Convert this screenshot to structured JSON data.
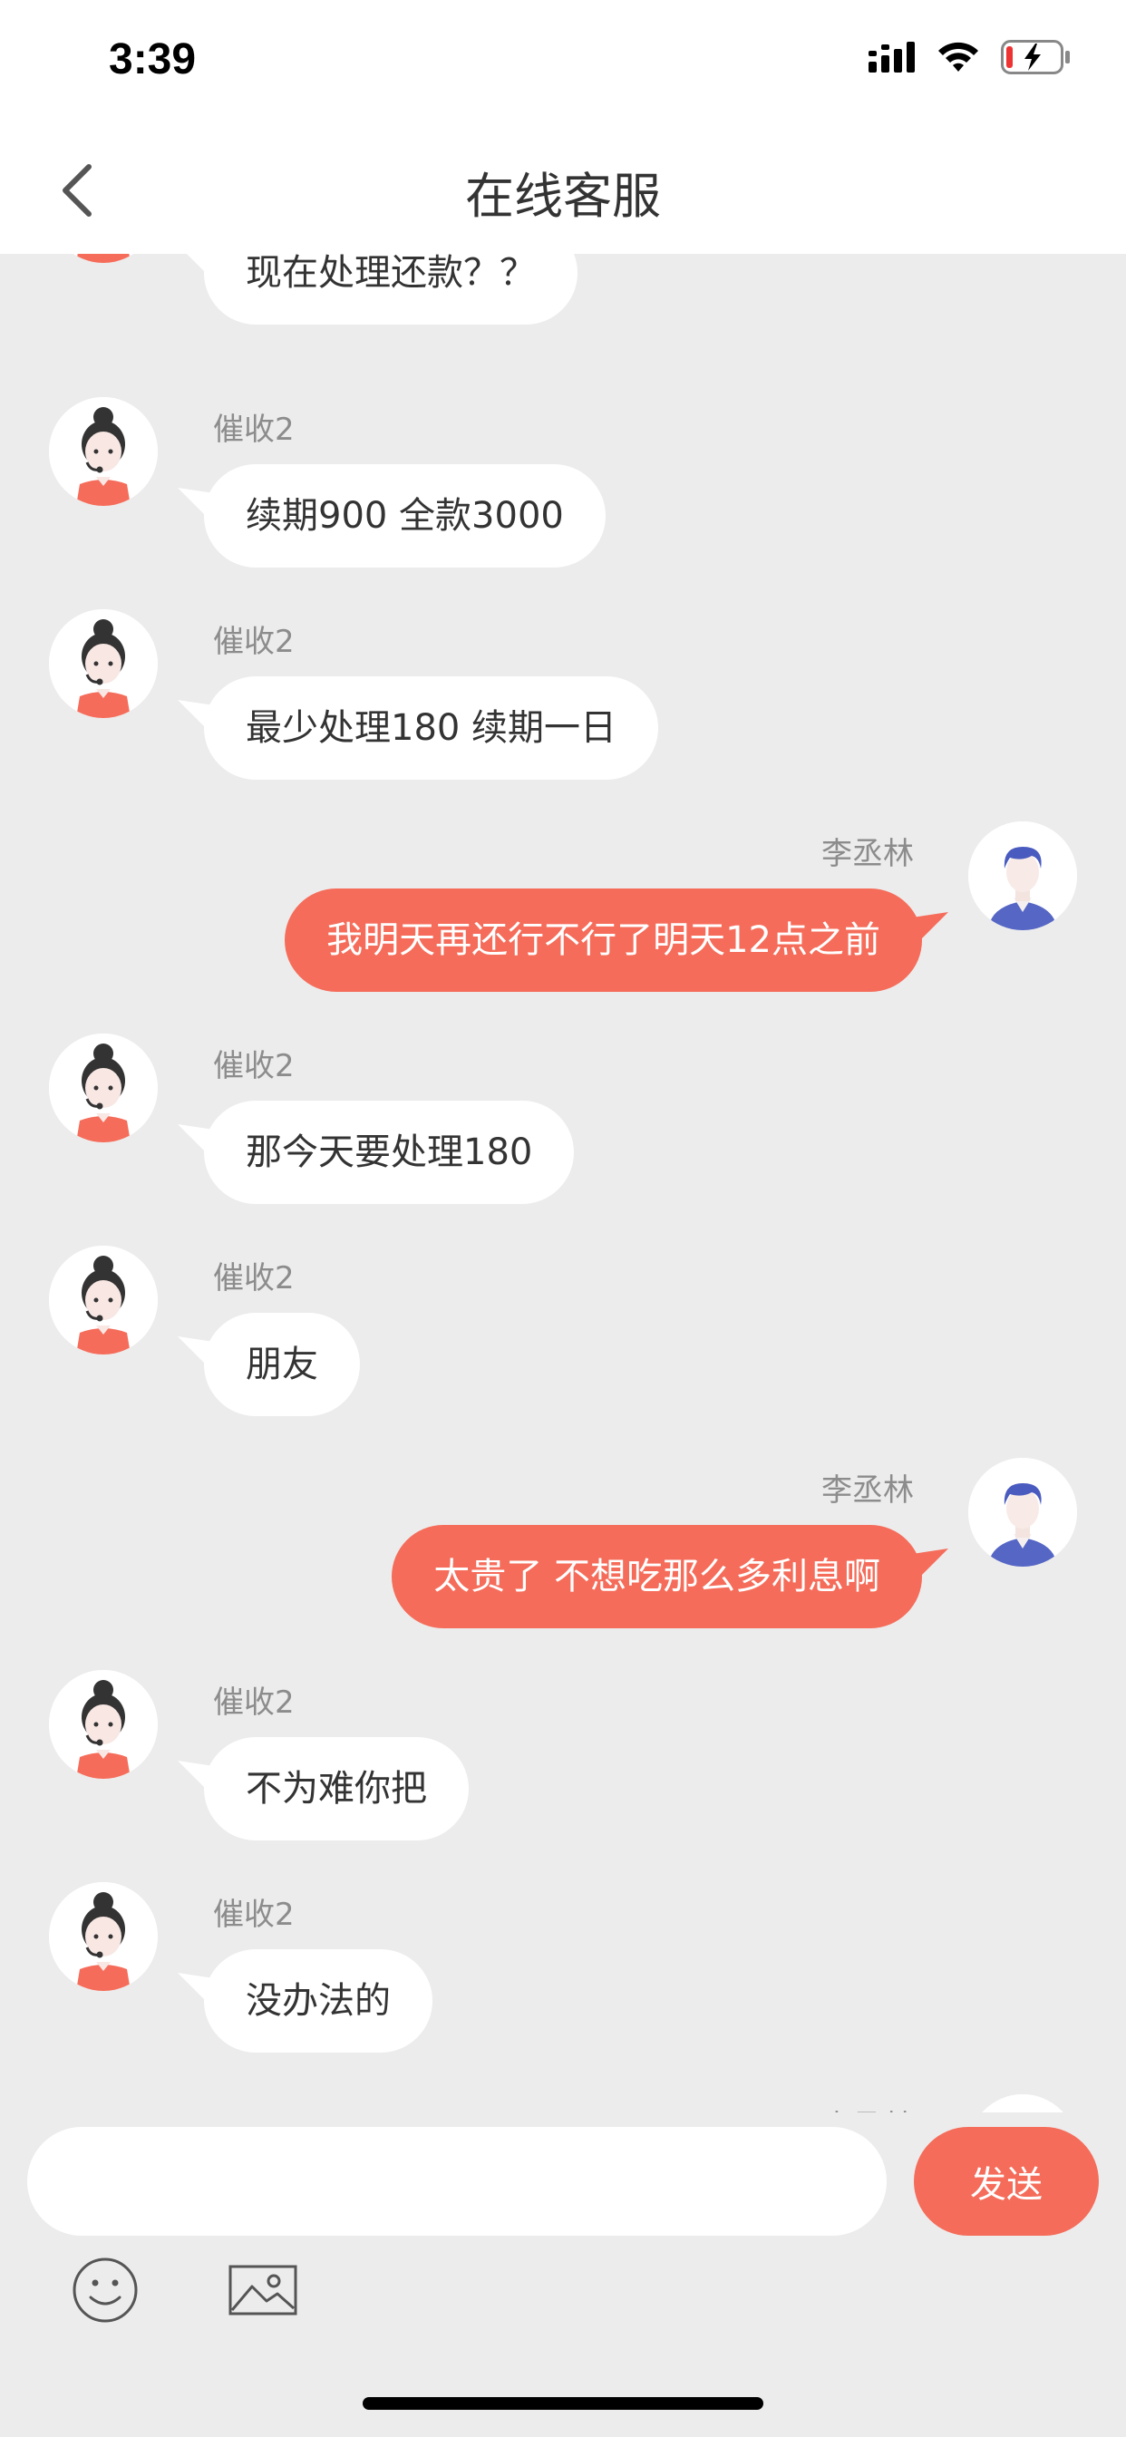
{
  "status_bar": {
    "time": "3:39"
  },
  "nav": {
    "title": "在线客服"
  },
  "messages": [
    {
      "side": "left",
      "sender": "",
      "text": "现在处理还款？？",
      "partial": true
    },
    {
      "side": "left",
      "sender": "催收2",
      "text": "续期900 全款3000"
    },
    {
      "side": "left",
      "sender": "催收2",
      "text": "最少处理180 续期一日"
    },
    {
      "side": "right",
      "sender": "李丞林",
      "text": "我明天再还行不行了明天12点之前"
    },
    {
      "side": "left",
      "sender": "催收2",
      "text": "那今天要处理180"
    },
    {
      "side": "left",
      "sender": "催收2",
      "text": "朋友"
    },
    {
      "side": "right",
      "sender": "李丞林",
      "text": "太贵了 不想吃那么多利息啊"
    },
    {
      "side": "left",
      "sender": "催收2",
      "text": "不为难你把"
    },
    {
      "side": "left",
      "sender": "催收2",
      "text": "没办法的"
    },
    {
      "side": "right",
      "sender": "李丞林",
      "text": "",
      "partial": true
    }
  ],
  "input": {
    "placeholder": "",
    "send_label": "发送"
  },
  "icons": {
    "emoji": "smiley-icon",
    "image": "image-icon"
  },
  "colors": {
    "accent": "#f56c5a",
    "background": "#ececec",
    "bubble_left": "#ffffff"
  }
}
